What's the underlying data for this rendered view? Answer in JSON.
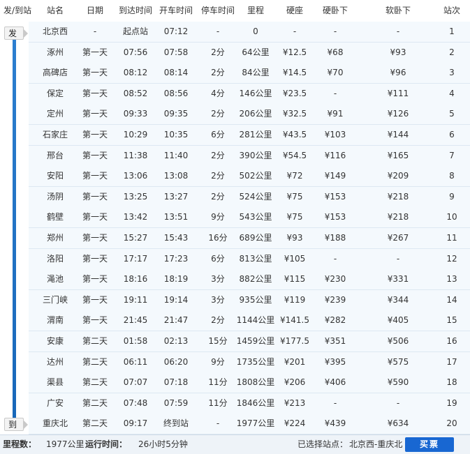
{
  "header": {
    "cols": [
      "发/到站",
      "站名",
      "日期",
      "到达时间",
      "开车时间",
      "停车时间",
      "里程",
      "硬座",
      "硬卧下",
      "软卧下",
      "站次"
    ]
  },
  "side": {
    "start_label": "发",
    "end_label": "到"
  },
  "rows": [
    [
      "北京西",
      "-",
      "起点站",
      "07:12",
      "-",
      "0",
      "-",
      "-",
      "-",
      "1"
    ],
    [
      "涿州",
      "第一天",
      "07:56",
      "07:58",
      "2分",
      "64公里",
      "¥12.5",
      "¥68",
      "¥93",
      "2"
    ],
    [
      "高碑店",
      "第一天",
      "08:12",
      "08:14",
      "2分",
      "84公里",
      "¥14.5",
      "¥70",
      "¥96",
      "3"
    ],
    [
      "保定",
      "第一天",
      "08:52",
      "08:56",
      "4分",
      "146公里",
      "¥23.5",
      "-",
      "¥111",
      "4"
    ],
    [
      "定州",
      "第一天",
      "09:33",
      "09:35",
      "2分",
      "206公里",
      "¥32.5",
      "¥91",
      "¥126",
      "5"
    ],
    [
      "石家庄",
      "第一天",
      "10:29",
      "10:35",
      "6分",
      "281公里",
      "¥43.5",
      "¥103",
      "¥144",
      "6"
    ],
    [
      "邢台",
      "第一天",
      "11:38",
      "11:40",
      "2分",
      "390公里",
      "¥54.5",
      "¥116",
      "¥165",
      "7"
    ],
    [
      "安阳",
      "第一天",
      "13:06",
      "13:08",
      "2分",
      "502公里",
      "¥72",
      "¥149",
      "¥209",
      "8"
    ],
    [
      "汤阴",
      "第一天",
      "13:25",
      "13:27",
      "2分",
      "524公里",
      "¥75",
      "¥153",
      "¥218",
      "9"
    ],
    [
      "鹤壁",
      "第一天",
      "13:42",
      "13:51",
      "9分",
      "543公里",
      "¥75",
      "¥153",
      "¥218",
      "10"
    ],
    [
      "郑州",
      "第一天",
      "15:27",
      "15:43",
      "16分",
      "689公里",
      "¥93",
      "¥188",
      "¥267",
      "11"
    ],
    [
      "洛阳",
      "第一天",
      "17:17",
      "17:23",
      "6分",
      "813公里",
      "¥105",
      "-",
      "-",
      "12"
    ],
    [
      "渑池",
      "第一天",
      "18:16",
      "18:19",
      "3分",
      "882公里",
      "¥115",
      "¥230",
      "¥331",
      "13"
    ],
    [
      "三门峡",
      "第一天",
      "19:11",
      "19:14",
      "3分",
      "935公里",
      "¥119",
      "¥239",
      "¥344",
      "14"
    ],
    [
      "渭南",
      "第一天",
      "21:45",
      "21:47",
      "2分",
      "1144公里",
      "¥141.5",
      "¥282",
      "¥405",
      "15"
    ],
    [
      "安康",
      "第二天",
      "01:58",
      "02:13",
      "15分",
      "1459公里",
      "¥177.5",
      "¥351",
      "¥506",
      "16"
    ],
    [
      "达州",
      "第二天",
      "06:11",
      "06:20",
      "9分",
      "1735公里",
      "¥201",
      "¥395",
      "¥575",
      "17"
    ],
    [
      "渠县",
      "第二天",
      "07:07",
      "07:18",
      "11分",
      "1808公里",
      "¥206",
      "¥406",
      "¥590",
      "18"
    ],
    [
      "广安",
      "第二天",
      "07:48",
      "07:59",
      "11分",
      "1846公里",
      "¥213",
      "-",
      "-",
      "19"
    ],
    [
      "重庆北",
      "第二天",
      "09:17",
      "终到站",
      "-",
      "1977公里",
      "¥224",
      "¥439",
      "¥634",
      "20"
    ]
  ],
  "footer": {
    "distance_label": "里程数：",
    "distance_value": "1977公里",
    "runtime_label": "运行时间：",
    "runtime_value": "26小时5分钟",
    "selected_label": "已选择站点：",
    "selected_value": "北京西-重庆北",
    "buy_label": "买票"
  },
  "colors": {
    "row_bg": "#f4f9fd",
    "rail": "#1867b9",
    "buy_button": "#1867d2"
  }
}
